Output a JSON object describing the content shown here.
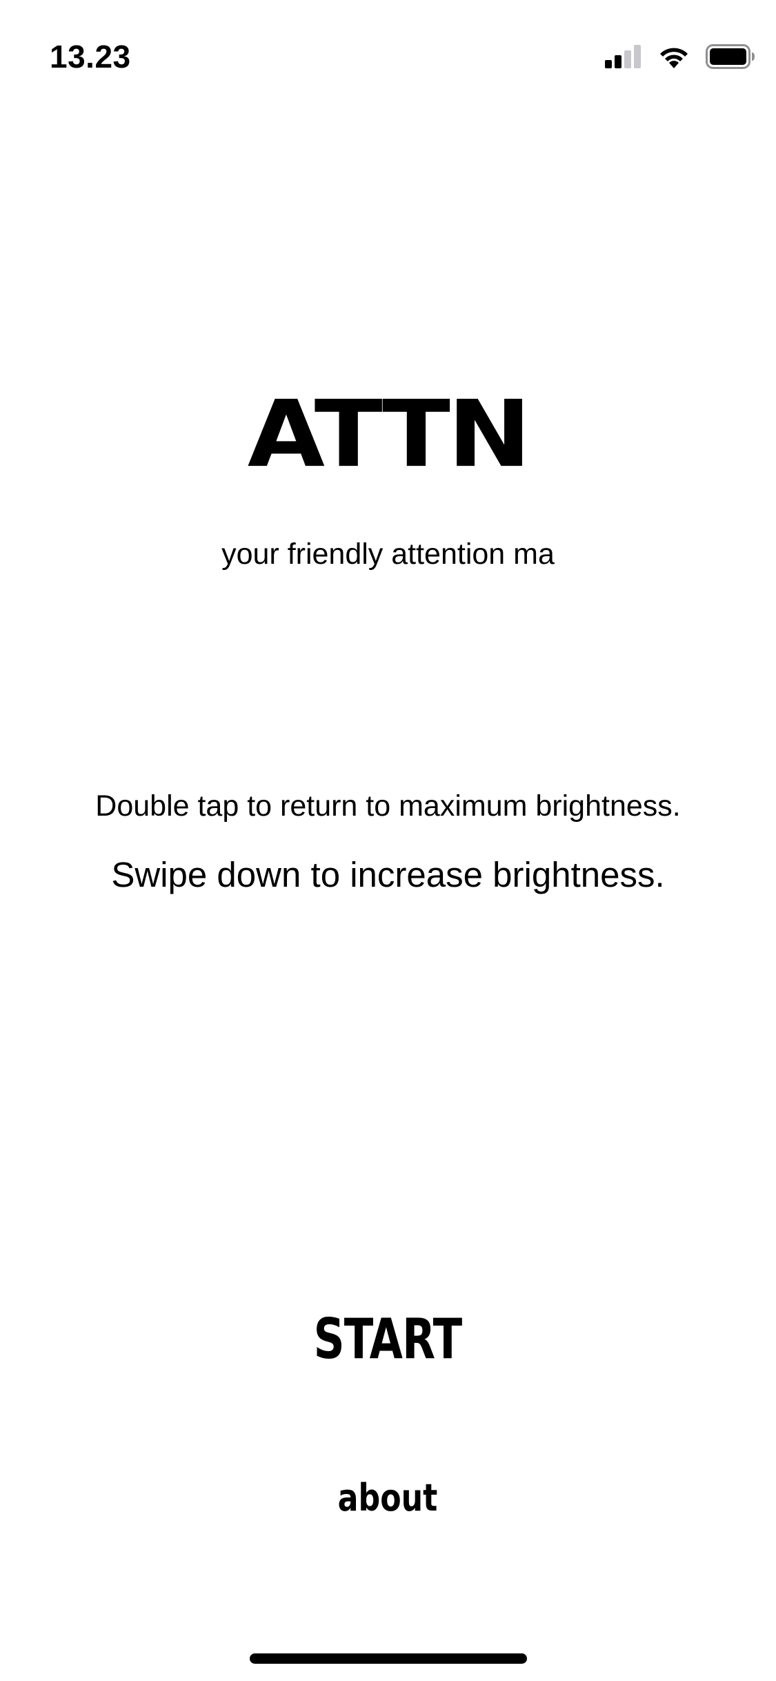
{
  "status_bar": {
    "time": "13.23",
    "icons": [
      "signal-icon",
      "wifi-icon",
      "battery-icon"
    ]
  },
  "app": {
    "title": "ATTN",
    "tagline": "your friendly attention ma"
  },
  "hints": {
    "double_tap": "Double tap to return to maximum brightness.",
    "swipe_down": "Swipe down to increase brightness."
  },
  "actions": {
    "start_label": "START",
    "about_label": "about"
  },
  "colors": {
    "background": "#ffffff",
    "text": "#000000",
    "signal_inactive": "#c7c7cc"
  }
}
